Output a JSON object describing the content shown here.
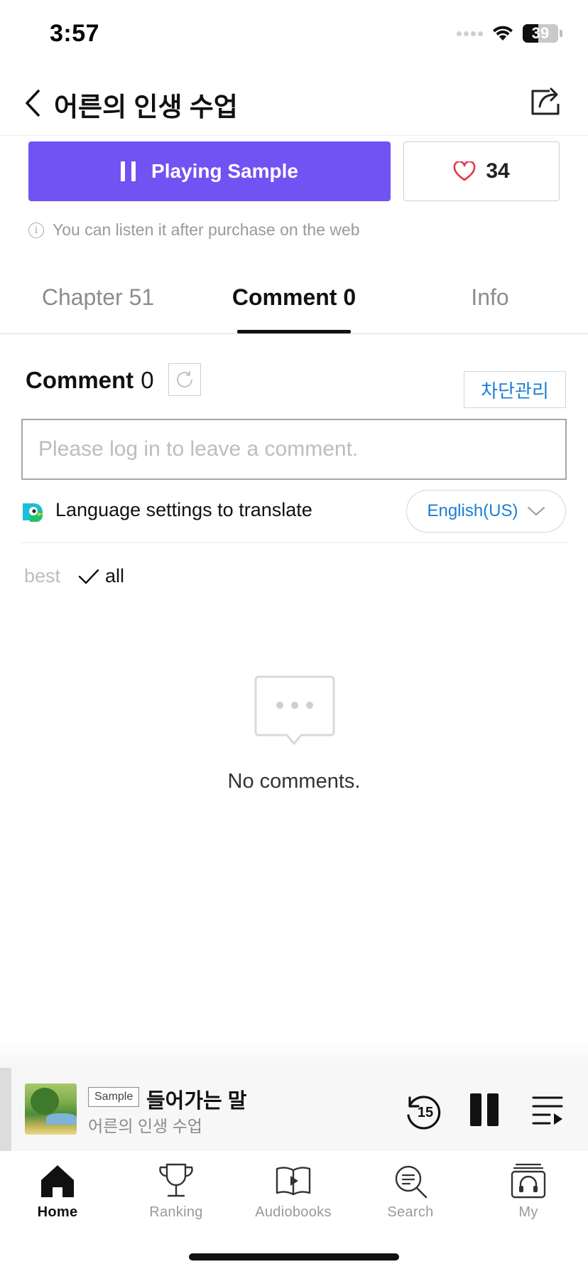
{
  "status_bar": {
    "time": "3:57",
    "battery": "39",
    "icons": [
      "signal-icon",
      "wifi-icon",
      "battery-icon"
    ]
  },
  "header": {
    "title": "어른의 인생 수업",
    "icons": [
      "back-arrow-icon",
      "share-icon"
    ]
  },
  "actions": {
    "play_label": "Playing Sample",
    "like_count": "34",
    "notice": "You can listen it after purchase on the web",
    "accent_color": "#7152f3",
    "icons": [
      "pause-icon",
      "heart-icon",
      "info-icon"
    ]
  },
  "tabs": [
    {
      "label": "Chapter 51",
      "active": false
    },
    {
      "label": "Comment 0",
      "active": true
    },
    {
      "label": "Info",
      "active": false
    }
  ],
  "comments": {
    "heading": "Comment",
    "count": "0",
    "block_manage_label": "차단관리",
    "input_placeholder": "Please log in to leave a comment.",
    "language_label": "Language settings to translate",
    "language_selected": "English(US)",
    "filter_best": "best",
    "filter_all": "all",
    "filter_selected": "all",
    "empty_text": "No comments.",
    "link_color": "#1a7fd6",
    "icons": [
      "refresh-icon",
      "papago-translate-icon",
      "chevron-down-icon",
      "checkmark-icon",
      "speech-bubble-icon"
    ]
  },
  "mini_player": {
    "badge": "Sample",
    "track_title": "들어가는 말",
    "book_title": "어른의 인생 수업",
    "rewind_seconds": "15",
    "icons": [
      "rewind-15-icon",
      "pause-icon",
      "playlist-icon"
    ]
  },
  "nav": [
    {
      "label": "Home",
      "icon": "home-icon",
      "active": true
    },
    {
      "label": "Ranking",
      "icon": "trophy-icon",
      "active": false
    },
    {
      "label": "Audiobooks",
      "icon": "open-book-play-icon",
      "active": false
    },
    {
      "label": "Search",
      "icon": "search-icon",
      "active": false
    },
    {
      "label": "My",
      "icon": "headphones-library-icon",
      "active": false
    }
  ]
}
